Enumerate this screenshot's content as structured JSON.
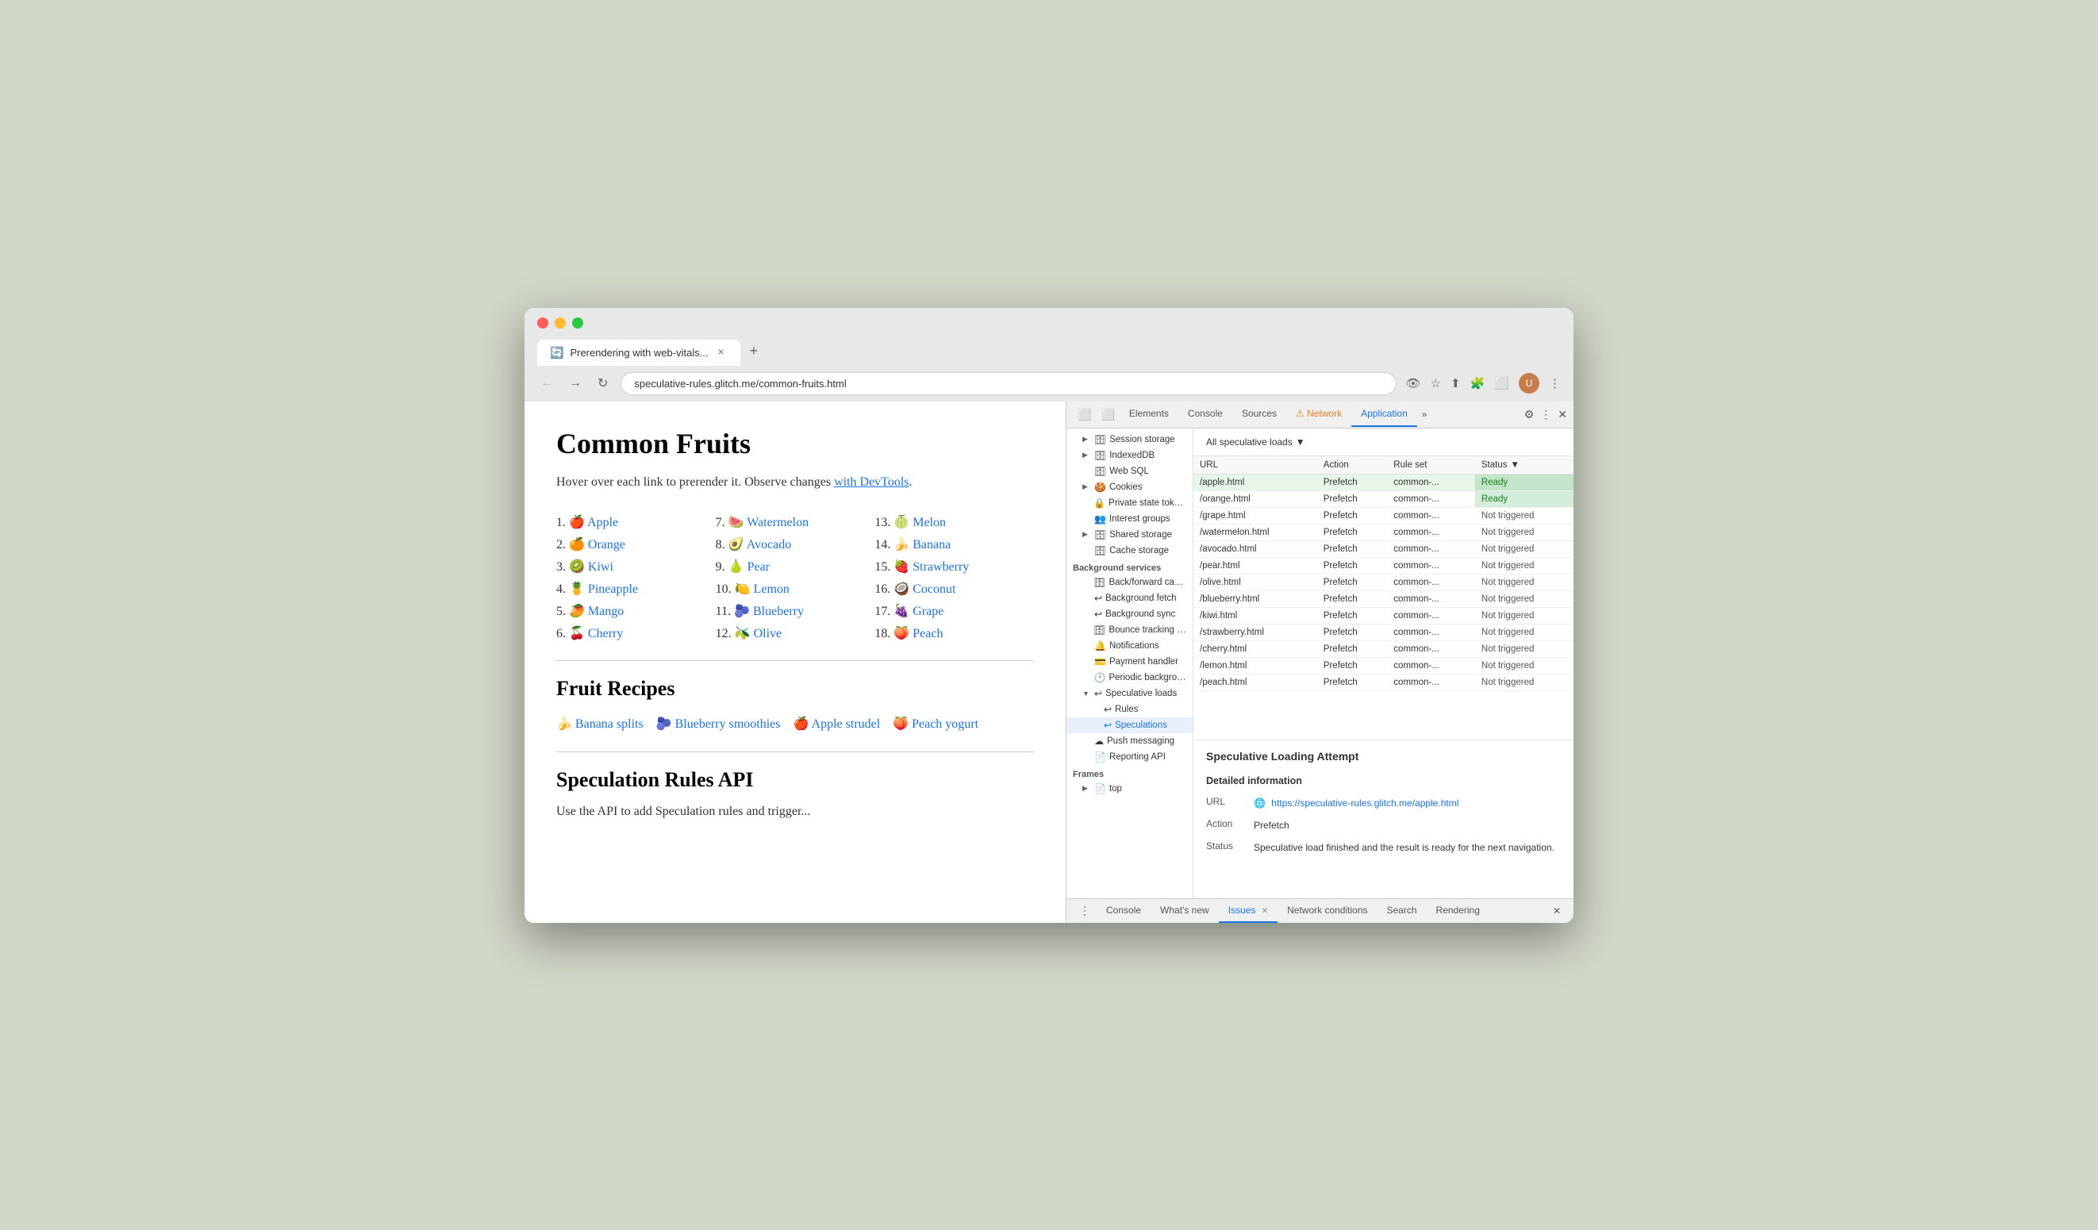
{
  "browser": {
    "tab_title": "Prerendering with web-vitals...",
    "tab_favicon": "🔄",
    "url": "speculative-rules.glitch.me/common-fruits.html",
    "new_tab_label": "+"
  },
  "page": {
    "title": "Common Fruits",
    "intro_text": "Hover over each link to prerender it. Observe changes ",
    "intro_link_text": "with DevTools",
    "intro_link2": ".",
    "fruits": [
      {
        "num": "1.",
        "emoji": "🍎",
        "name": "Apple",
        "href": "#"
      },
      {
        "num": "2.",
        "emoji": "🍊",
        "name": "Orange",
        "href": "#"
      },
      {
        "num": "3.",
        "emoji": "🥝",
        "name": "Kiwi",
        "href": "#"
      },
      {
        "num": "4.",
        "emoji": "🍍",
        "name": "Pineapple",
        "href": "#"
      },
      {
        "num": "5.",
        "emoji": "🥭",
        "name": "Mango",
        "href": "#"
      },
      {
        "num": "6.",
        "emoji": "🍒",
        "name": "Cherry",
        "href": "#"
      },
      {
        "num": "7.",
        "emoji": "🍉",
        "name": "Watermelon",
        "href": "#"
      },
      {
        "num": "8.",
        "emoji": "🥑",
        "name": "Avocado",
        "href": "#"
      },
      {
        "num": "9.",
        "emoji": "🍐",
        "name": "Pear",
        "href": "#"
      },
      {
        "num": "10.",
        "emoji": "🍋",
        "name": "Lemon",
        "href": "#"
      },
      {
        "num": "11.",
        "emoji": "🫐",
        "name": "Blueberry",
        "href": "#"
      },
      {
        "num": "12.",
        "emoji": "🫒",
        "name": "Olive",
        "href": "#"
      },
      {
        "num": "13.",
        "emoji": "🍈",
        "name": "Melon",
        "href": "#"
      },
      {
        "num": "14.",
        "emoji": "🍌",
        "name": "Banana",
        "href": "#"
      },
      {
        "num": "15.",
        "emoji": "🍓",
        "name": "Strawberry",
        "href": "#"
      },
      {
        "num": "16.",
        "emoji": "🥥",
        "name": "Coconut",
        "href": "#"
      },
      {
        "num": "17.",
        "emoji": "🍇",
        "name": "Grape",
        "href": "#"
      },
      {
        "num": "18.",
        "emoji": "🍑",
        "name": "Peach",
        "href": "#"
      }
    ],
    "recipes_title": "Fruit Recipes",
    "recipes": [
      {
        "emoji": "🍌",
        "name": "Banana splits"
      },
      {
        "emoji": "🫐",
        "name": "Blueberry smoothies"
      },
      {
        "emoji": "🍎",
        "name": "Apple strudel"
      },
      {
        "emoji": "🍑",
        "name": "Peach yogurt"
      }
    ],
    "api_title": "Speculation Rules API",
    "api_text": "Use the API to add Speculation rules and trigger..."
  },
  "devtools": {
    "tabs": [
      "Elements",
      "Console",
      "Sources",
      "Network",
      "Application"
    ],
    "active_tab": "Application",
    "warning_tab": "Network",
    "more_label": "»",
    "filter_label": "All speculative loads",
    "table_headers": [
      "URL",
      "Action",
      "Rule set",
      "Status"
    ],
    "rows": [
      {
        "url": "/apple.html",
        "action": "Prefetch",
        "ruleset": "common-...",
        "status": "Ready",
        "highlighted": true
      },
      {
        "url": "/orange.html",
        "action": "Prefetch",
        "ruleset": "common-...",
        "status": "Ready",
        "highlighted": false
      },
      {
        "url": "/grape.html",
        "action": "Prefetch",
        "ruleset": "common-...",
        "status": "Not triggered",
        "highlighted": false
      },
      {
        "url": "/watermelon.html",
        "action": "Prefetch",
        "ruleset": "common-...",
        "status": "Not triggered",
        "highlighted": false
      },
      {
        "url": "/avocado.html",
        "action": "Prefetch",
        "ruleset": "common-...",
        "status": "Not triggered",
        "highlighted": false
      },
      {
        "url": "/pear.html",
        "action": "Prefetch",
        "ruleset": "common-...",
        "status": "Not triggered",
        "highlighted": false
      },
      {
        "url": "/olive.html",
        "action": "Prefetch",
        "ruleset": "common-...",
        "status": "Not triggered",
        "highlighted": false
      },
      {
        "url": "/blueberry.html",
        "action": "Prefetch",
        "ruleset": "common-...",
        "status": "Not triggered",
        "highlighted": false
      },
      {
        "url": "/kiwi.html",
        "action": "Prefetch",
        "ruleset": "common-...",
        "status": "Not triggered",
        "highlighted": false
      },
      {
        "url": "/strawberry.html",
        "action": "Prefetch",
        "ruleset": "common-...",
        "status": "Not triggered",
        "highlighted": false
      },
      {
        "url": "/cherry.html",
        "action": "Prefetch",
        "ruleset": "common-...",
        "status": "Not triggered",
        "highlighted": false
      },
      {
        "url": "/lemon.html",
        "action": "Prefetch",
        "ruleset": "common-...",
        "status": "Not triggered",
        "highlighted": false
      },
      {
        "url": "/peach.html",
        "action": "Prefetch",
        "ruleset": "common-...",
        "status": "Not triggered",
        "highlighted": false
      }
    ],
    "sidebar": {
      "sections": [
        {
          "items": [
            {
              "label": "Session storage",
              "icon": "🗄",
              "indent": 1,
              "arrow": "▶"
            },
            {
              "label": "IndexedDB",
              "icon": "🗄",
              "indent": 1,
              "arrow": "▶"
            },
            {
              "label": "Web SQL",
              "icon": "🗄",
              "indent": 1
            },
            {
              "label": "Cookies",
              "icon": "🍪",
              "indent": 1,
              "arrow": "▶"
            },
            {
              "label": "Private state tokens",
              "icon": "🔒",
              "indent": 1
            },
            {
              "label": "Interest groups",
              "icon": "👥",
              "indent": 1
            },
            {
              "label": "Shared storage",
              "icon": "🗄",
              "indent": 1,
              "arrow": "▶"
            },
            {
              "label": "Cache storage",
              "icon": "🗄",
              "indent": 1
            }
          ]
        },
        {
          "header": "Background services",
          "items": [
            {
              "label": "Back/forward cache",
              "icon": "🗄",
              "indent": 1
            },
            {
              "label": "Background fetch",
              "icon": "↩",
              "indent": 1
            },
            {
              "label": "Background sync",
              "icon": "↩",
              "indent": 1
            },
            {
              "label": "Bounce tracking m...",
              "icon": "🗄",
              "indent": 1
            },
            {
              "label": "Notifications",
              "icon": "🔔",
              "indent": 1
            },
            {
              "label": "Payment handler",
              "icon": "💳",
              "indent": 1
            },
            {
              "label": "Periodic background...",
              "icon": "🕐",
              "indent": 1
            },
            {
              "label": "Speculative loads",
              "icon": "↩",
              "indent": 1,
              "arrow": "▶",
              "expanded": true
            },
            {
              "label": "Rules",
              "icon": "↩",
              "indent": 2
            },
            {
              "label": "Speculations",
              "icon": "↩",
              "indent": 2,
              "selected": true
            },
            {
              "label": "Push messaging",
              "icon": "☁",
              "indent": 1
            },
            {
              "label": "Reporting API",
              "icon": "📄",
              "indent": 1
            }
          ]
        },
        {
          "header": "Frames",
          "items": [
            {
              "label": "top",
              "icon": "📄",
              "indent": 1,
              "arrow": "▶"
            }
          ]
        }
      ]
    },
    "detail": {
      "title": "Speculative Loading Attempt",
      "subtitle": "Detailed information",
      "url_label": "URL",
      "url_value": "https://speculative-rules.glitch.me/apple.html",
      "action_label": "Action",
      "action_value": "Prefetch",
      "status_label": "Status",
      "status_value": "Speculative load finished and the result is ready for the next navigation."
    },
    "bottom_tabs": [
      "Console",
      "What's new",
      "Issues",
      "Network conditions",
      "Search",
      "Rendering"
    ]
  }
}
